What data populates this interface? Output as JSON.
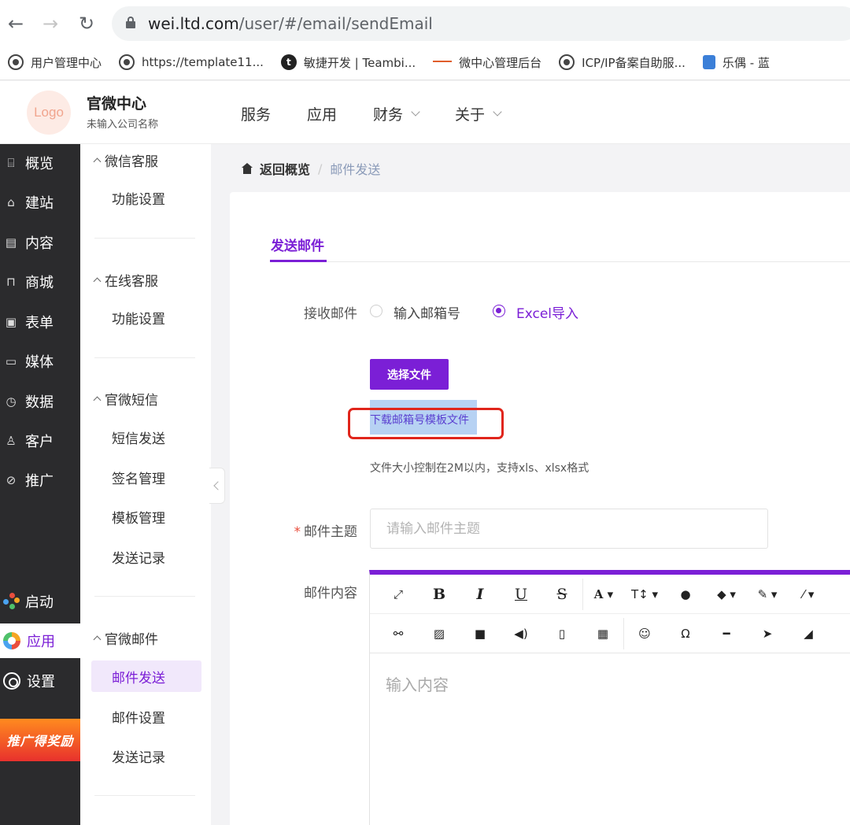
{
  "browser": {
    "url_host": "wei.ltd.com",
    "url_path": "/user/#/email/sendEmail",
    "bookmarks": [
      {
        "icon": "globe-icon",
        "label": "用户管理中心"
      },
      {
        "icon": "globe-icon",
        "label": "https://template11..."
      },
      {
        "icon": "teambition-icon",
        "label": "敏捷开发 | Teambi..."
      },
      {
        "icon": "weizhongxin-icon",
        "label": "微中心管理后台"
      },
      {
        "icon": "globe-icon",
        "label": "ICP/IP备案自助服..."
      },
      {
        "icon": "robot-icon",
        "label": "乐偶 - 蓝"
      }
    ]
  },
  "header": {
    "logo_text": "Logo",
    "brand_title": "官微中心",
    "brand_subtitle": "未输入公司名称",
    "nav": [
      "服务",
      "应用",
      "财务",
      "关于"
    ]
  },
  "dark_sidebar": {
    "items": [
      {
        "icon": "chart-icon",
        "glyph": "⌸",
        "label": "概览"
      },
      {
        "icon": "home-icon",
        "glyph": "⌂",
        "label": "建站"
      },
      {
        "icon": "document-icon",
        "glyph": "▤",
        "label": "内容"
      },
      {
        "icon": "cart-icon",
        "glyph": "⊓",
        "label": "商城"
      },
      {
        "icon": "form-icon",
        "glyph": "▣",
        "label": "表单"
      },
      {
        "icon": "media-icon",
        "glyph": "▭",
        "label": "媒体"
      },
      {
        "icon": "clock-icon",
        "glyph": "◷",
        "label": "数据"
      },
      {
        "icon": "user-icon",
        "glyph": "♙",
        "label": "客户"
      },
      {
        "icon": "promote-icon",
        "glyph": "⊘",
        "label": "推广"
      }
    ],
    "launch_label": "启动",
    "app_label": "应用",
    "settings_label": "设置",
    "promo_text": "推广得奖励"
  },
  "submenu": {
    "groups": [
      {
        "title": "微信客服",
        "items": [
          "功能设置"
        ]
      },
      {
        "title": "在线客服",
        "items": [
          "功能设置"
        ]
      },
      {
        "title": "官微短信",
        "items": [
          "短信发送",
          "签名管理",
          "模板管理",
          "发送记录"
        ]
      },
      {
        "title": "官微邮件",
        "items": [
          "邮件发送",
          "邮件设置",
          "发送记录"
        ]
      }
    ],
    "active_item": "邮件发送"
  },
  "breadcrumb": {
    "back": "返回概览",
    "separator": "/",
    "current": "邮件发送"
  },
  "form": {
    "tab_label": "发送邮件",
    "receive_label": "接收邮件",
    "radio_options": [
      "输入邮箱号",
      "Excel导入"
    ],
    "selected_radio": "Excel导入",
    "choose_file_label": "选择文件",
    "download_template_link": "下载邮箱号模板文件",
    "file_hint": "文件大小控制在2M以内，支持xls、xlsx格式",
    "required_mark": "*",
    "subject_label": "邮件主题",
    "subject_placeholder": "请输入邮件主题",
    "content_label": "邮件内容",
    "editor_placeholder": "输入内容"
  },
  "editor_toolbar": {
    "row1": [
      "⤢",
      "B",
      "I",
      "U",
      "S",
      "A ▾",
      "T↕ ▾",
      "●",
      "◆ ▾",
      "✎ ▾",
      "⁄ ▾"
    ],
    "row2": [
      "⚯",
      "▨",
      "■",
      "◀)",
      "▯",
      "▦",
      "☺",
      "Ω",
      "━",
      "➤",
      "◢"
    ]
  },
  "colors": {
    "accent": "#7b1fd6",
    "highlight_box": "#e0251b",
    "sidebar_dark": "#2b2b2d"
  }
}
